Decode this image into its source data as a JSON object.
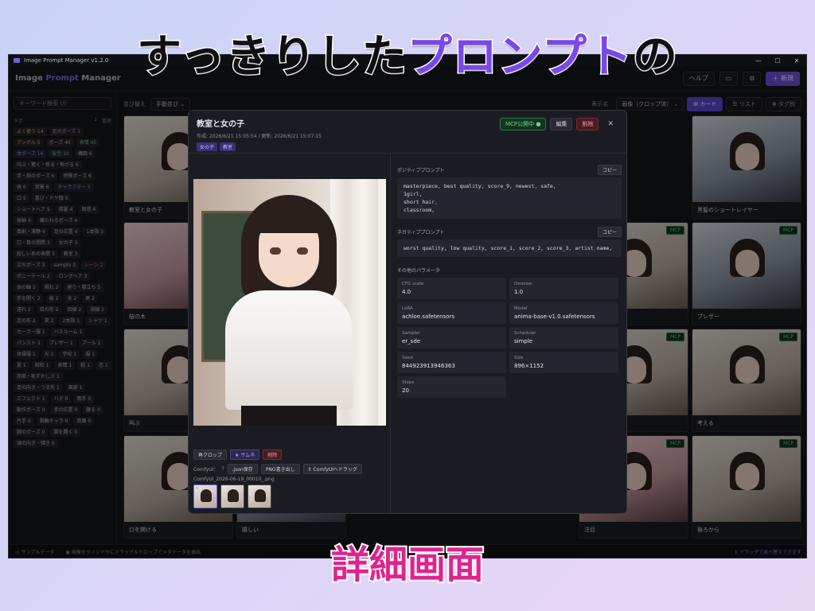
{
  "banner": {
    "headline_black": "すっきりした",
    "headline_purple": "プロンプト",
    "headline_tail": "の",
    "footer": "詳細画面"
  },
  "window": {
    "title": "Image Prompt Manager v1.2.0",
    "min": "—",
    "max": "☐",
    "close": "✕"
  },
  "header": {
    "brand_pre": "Image ",
    "brand_accent": "Prompt",
    "brand_post": " Manager",
    "help": "ヘルプ",
    "monitor_icon": "▭",
    "gear_icon": "⚙",
    "new_label": "＋ 新規"
  },
  "sidebar": {
    "search_placeholder": "キーワード検索 (/)",
    "tags_label": "タグ",
    "tags_count": "1",
    "tags_manage": "管理",
    "tags": [
      {
        "label": "よく使う 14",
        "c": "c1"
      },
      {
        "label": "足のポーズ 1",
        "c": "c2"
      },
      {
        "label": "アングル 5",
        "c": "c1"
      },
      {
        "label": "ポーズ 40",
        "c": ""
      },
      {
        "label": "表情 45",
        "c": "c4"
      },
      {
        "label": "体ポーズ 14",
        "c": "c3"
      },
      {
        "label": "髪型 10",
        "c": "c4"
      },
      {
        "label": "構図 6",
        "c": ""
      },
      {
        "label": "叫ぶ・驚く・焦る・怖がる 6",
        "c": ""
      },
      {
        "label": "手・指のポーズ 6",
        "c": ""
      },
      {
        "label": "特殊ポーズ 6",
        "c": ""
      },
      {
        "label": "表 6",
        "c": ""
      },
      {
        "label": "背景 6",
        "c": ""
      },
      {
        "label": "キャラクター 5",
        "c": "c3"
      },
      {
        "label": "口 5",
        "c": ""
      },
      {
        "label": "喜び・ドヤ顔 5",
        "c": ""
      },
      {
        "label": "ショートヘア 5",
        "c": ""
      },
      {
        "label": "前髪 4",
        "c": ""
      },
      {
        "label": "困惑 4",
        "c": ""
      },
      {
        "label": "振袖 4",
        "c": ""
      },
      {
        "label": "横たわるポーズ 4",
        "c": ""
      },
      {
        "label": "真剣・凛静 4",
        "c": ""
      },
      {
        "label": "足の位置 4",
        "c": ""
      },
      {
        "label": "1本指 3",
        "c": ""
      },
      {
        "label": "口・目の開閉 3",
        "c": ""
      },
      {
        "label": "女の子 3",
        "c": ""
      },
      {
        "label": "寂しい系の表情 3",
        "c": ""
      },
      {
        "label": "教室 3",
        "c": ""
      },
      {
        "label": "立ちポーズ 3",
        "c": ""
      },
      {
        "label": "sample 3",
        "c": ""
      },
      {
        "label": "シーン 2",
        "c": "c5"
      },
      {
        "label": "ポニーテール 2",
        "c": ""
      },
      {
        "label": "ロングヘア 3",
        "c": ""
      },
      {
        "label": "体の軸 2",
        "c": ""
      },
      {
        "label": "照れ 2",
        "c": ""
      },
      {
        "label": "座り・寝立ち 5",
        "c": ""
      },
      {
        "label": "手を開く 2",
        "c": ""
      },
      {
        "label": "桜 2",
        "c": ""
      },
      {
        "label": "氷 2",
        "c": ""
      },
      {
        "label": "男 2",
        "c": ""
      },
      {
        "label": "遠れ 2",
        "c": ""
      },
      {
        "label": "目の形 2",
        "c": ""
      },
      {
        "label": "目線 2",
        "c": ""
      },
      {
        "label": "視線 2",
        "c": ""
      },
      {
        "label": "足の形 2",
        "c": ""
      },
      {
        "label": "笑 2",
        "c": ""
      },
      {
        "label": "2本指 1",
        "c": ""
      },
      {
        "label": "シャツ 1",
        "c": ""
      },
      {
        "label": "セーラー服 1",
        "c": ""
      },
      {
        "label": "バスルーム 1",
        "c": ""
      },
      {
        "label": "パンスト 1",
        "c": ""
      },
      {
        "label": "ブレザー 1",
        "c": ""
      },
      {
        "label": "プール 1",
        "c": ""
      },
      {
        "label": "体操服 1",
        "c": ""
      },
      {
        "label": "光 1",
        "c": ""
      },
      {
        "label": "学校 1",
        "c": ""
      },
      {
        "label": "服 1",
        "c": ""
      },
      {
        "label": "夏 1",
        "c": ""
      },
      {
        "label": "昭和 1",
        "c": ""
      },
      {
        "label": "表情 1",
        "c": ""
      },
      {
        "label": "殺 1",
        "c": ""
      },
      {
        "label": "恋 1",
        "c": ""
      },
      {
        "label": "赤面・恥ずかしさ 1",
        "c": ""
      },
      {
        "label": "足の向き・つま先 1",
        "c": ""
      },
      {
        "label": "風邪 1",
        "c": ""
      },
      {
        "label": "エフェクト 1",
        "c": ""
      },
      {
        "label": "ハグ 0",
        "c": ""
      },
      {
        "label": "雨手 0",
        "c": ""
      },
      {
        "label": "動作ポーズ 0",
        "c": ""
      },
      {
        "label": "手の位置 0",
        "c": ""
      },
      {
        "label": "腰る 0",
        "c": ""
      },
      {
        "label": "片手 0",
        "c": ""
      },
      {
        "label": "指輪キャラ 0",
        "c": ""
      },
      {
        "label": "両風 0",
        "c": ""
      },
      {
        "label": "腕のポーズ 0",
        "c": ""
      },
      {
        "label": "脚を開く 0",
        "c": ""
      },
      {
        "label": "頭の向き・傾き 0",
        "c": ""
      }
    ]
  },
  "toolbar": {
    "sort_label": "並び替え",
    "sort_value": "手動並び ⌄",
    "show_label": "表示名",
    "show_value": "画像（クロップ済） ⌄",
    "view_card": "⊞ カード",
    "view_list": "☰ リスト",
    "view_tag": "⊗ タグ別"
  },
  "cards": [
    {
      "label": "教室と女の子",
      "mcp": ""
    },
    {
      "label": "黒髪のショートレイヤー",
      "mcp": ""
    },
    {
      "label": "桜の木",
      "mcp": ""
    },
    {
      "label": "ブレザー",
      "mcp": "MCP"
    },
    {
      "label": "叫ぶ",
      "mcp": ""
    },
    {
      "label": "考える",
      "mcp": "MCP"
    },
    {
      "label": "口を開ける",
      "mcp": ""
    },
    {
      "label": "嬉しい",
      "mcp": ""
    },
    {
      "label": "注目",
      "mcp": "MCP"
    },
    {
      "label": "後ろから",
      "mcp": "MCP"
    }
  ],
  "card_mcp_mid": "MCP",
  "statusbar": {
    "sample": "▭ サンプルデータ",
    "hint": "▣ 画像をウィンドウにドラッグ＆ドロップでメタデータを抽出",
    "right": "↕ ドラッグで並べ替えできます"
  },
  "modal": {
    "title": "教室と女の子",
    "meta": "作成: 2026/6/21 15:05:54 / 更新: 2026/6/21 15:07:15",
    "tags": [
      "女の子",
      "教室"
    ],
    "mcp_btn": "MCP公開中 ●",
    "edit_btn": "編集",
    "delete_btn": "削除",
    "close_btn": "✕",
    "recrop_btn": "再クロップ",
    "thumb_btn": "★ サムネ",
    "img_delete_btn": "削除",
    "comfy_label": "ComfyUI：",
    "comfy_help": "?",
    "json_btn": ".json保存",
    "png_btn": "PNG書き出し",
    "drag_btn": "⇕ ComfyUIへドラッグ",
    "filename": "ComfyUI_2026-06-19_00010_.png",
    "pos_label": "ポジティブプロンプト",
    "pos_copy": "コピー",
    "pos_text": "masterpiece, best quality, score_9, newest, safe,\n1girl,\nshort hair,\nclassroom,",
    "neg_label": "ネガティブプロンプト",
    "neg_copy": "コピー",
    "neg_text": "worst quality, low quality, score_1, score_2, score_3, artist name,",
    "params_label": "その他のパラメータ",
    "params": [
      {
        "k": "CFG scale",
        "v": "4.0"
      },
      {
        "k": "Denoise",
        "v": "1.0"
      },
      {
        "k": "LoRA",
        "v": "achloe.safetensors"
      },
      {
        "k": "Model",
        "v": "anima-base-v1.0.safetensors"
      },
      {
        "k": "Sampler",
        "v": "er_sde"
      },
      {
        "k": "Scheduler",
        "v": "simple"
      },
      {
        "k": "Seed",
        "v": "844923913946363"
      },
      {
        "k": "Size",
        "v": "896×1152"
      },
      {
        "k": "Steps",
        "v": "20"
      }
    ]
  }
}
